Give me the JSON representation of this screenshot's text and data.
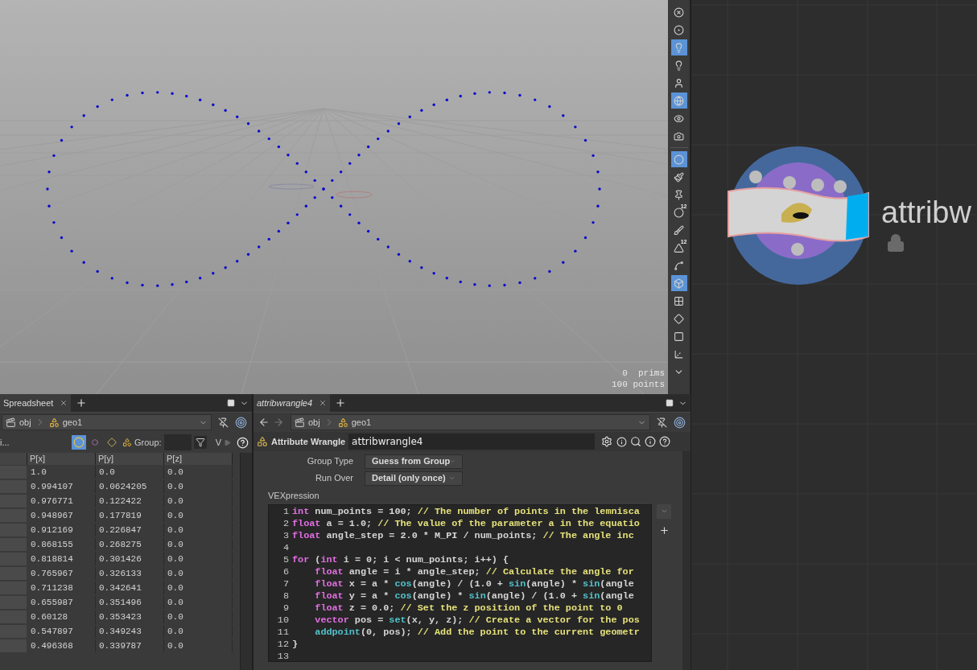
{
  "viewport": {
    "stats": [
      "0  prims",
      "100 points"
    ]
  },
  "viewport_toolbar": [
    {
      "kind": "xray",
      "selected": false
    },
    {
      "kind": "light-circle",
      "selected": false
    },
    {
      "kind": "bulb",
      "selected": true
    },
    {
      "kind": "bulb-small",
      "selected": false
    },
    {
      "kind": "person-bulb",
      "selected": false
    },
    {
      "kind": "shaded-ball",
      "selected": true
    },
    {
      "kind": "eye",
      "selected": false
    },
    {
      "kind": "camera",
      "selected": false
    },
    {
      "kind": "point",
      "selected": true
    },
    {
      "kind": "brush",
      "selected": false
    },
    {
      "kind": "pin",
      "selected": false
    },
    {
      "kind": "point-numbers",
      "selected": false,
      "label": "12"
    },
    {
      "kind": "brush-small",
      "selected": false
    },
    {
      "kind": "prim-numbers",
      "selected": false,
      "label": "12"
    },
    {
      "kind": "curve",
      "selected": false
    },
    {
      "kind": "shaded-surface",
      "selected": true
    },
    {
      "kind": "checker",
      "selected": false
    },
    {
      "kind": "diamond",
      "selected": false
    },
    {
      "kind": "green-square",
      "selected": false
    },
    {
      "kind": "handle",
      "selected": false
    },
    {
      "kind": "down-arrow",
      "selected": false
    }
  ],
  "spreadsheet": {
    "tab": "Spreadsheet",
    "path": [
      "obj",
      "geo1"
    ],
    "filter_label": "i...",
    "group_label": "Group:",
    "view_label": "V",
    "columns": [
      "P[x]",
      "P[y]",
      "P[z]"
    ],
    "rows": [
      [
        "1.0",
        "0.0",
        "0.0"
      ],
      [
        "0.994107",
        "0.0624205",
        "0.0"
      ],
      [
        "0.976771",
        "0.122422",
        "0.0"
      ],
      [
        "0.948967",
        "0.177819",
        "0.0"
      ],
      [
        "0.912169",
        "0.226847",
        "0.0"
      ],
      [
        "0.868155",
        "0.268275",
        "0.0"
      ],
      [
        "0.818814",
        "0.301426",
        "0.0"
      ],
      [
        "0.765967",
        "0.326133",
        "0.0"
      ],
      [
        "0.711238",
        "0.342641",
        "0.0"
      ],
      [
        "0.655987",
        "0.351496",
        "0.0"
      ],
      [
        "0.60128",
        "0.353423",
        "0.0"
      ],
      [
        "0.547897",
        "0.349243",
        "0.0"
      ],
      [
        "0.496368",
        "0.339787",
        "0.0"
      ]
    ]
  },
  "parameters": {
    "tab": "attribwrangle4",
    "path": [
      "obj",
      "geo1"
    ],
    "node_type": "Attribute Wrangle",
    "node_name": "attribwrangle4",
    "fields": [
      {
        "label": "Group Type",
        "value": "Guess from Group"
      },
      {
        "label": "Run Over",
        "value": "Detail (only once)"
      }
    ],
    "code_label": "VEXpression",
    "code_lines": [
      {
        "number": "1",
        "indented": false,
        "segments": [
          {
            "kind": "keyword",
            "text": "int"
          },
          {
            "kind": "plain",
            "text": " num_points = 100; "
          },
          {
            "kind": "comment",
            "text": "// The number of points in the lemnisca"
          }
        ]
      },
      {
        "number": "2",
        "indented": false,
        "segments": [
          {
            "kind": "keyword",
            "text": "float"
          },
          {
            "kind": "plain",
            "text": " a = 1.0; "
          },
          {
            "kind": "comment",
            "text": "// The value of the parameter a in the equatio"
          }
        ]
      },
      {
        "number": "3",
        "indented": false,
        "segments": [
          {
            "kind": "keyword",
            "text": "float"
          },
          {
            "kind": "plain",
            "text": " angle_step = 2.0 * M_PI / num_points; "
          },
          {
            "kind": "comment",
            "text": "// The angle inc"
          }
        ]
      },
      {
        "number": "4"
      },
      {
        "number": "5",
        "indented": false,
        "segments": [
          {
            "kind": "keyword",
            "text": "for"
          },
          {
            "kind": "plain",
            "text": " ("
          },
          {
            "kind": "keyword",
            "text": "int"
          },
          {
            "kind": "plain",
            "text": " i = 0; i < num_points; i++) {"
          }
        ]
      },
      {
        "number": "6",
        "indented": true,
        "segments": [
          {
            "kind": "keyword",
            "text": "float"
          },
          {
            "kind": "plain",
            "text": " angle = i * angle_step; "
          },
          {
            "kind": "comment",
            "text": "// Calculate the angle for"
          }
        ]
      },
      {
        "number": "7",
        "indented": true,
        "segments": [
          {
            "kind": "keyword",
            "text": "float"
          },
          {
            "kind": "plain",
            "text": " x = a * "
          },
          {
            "kind": "function",
            "text": "cos"
          },
          {
            "kind": "plain",
            "text": "(angle) / (1.0 + "
          },
          {
            "kind": "function",
            "text": "sin"
          },
          {
            "kind": "plain",
            "text": "(angle) * "
          },
          {
            "kind": "function",
            "text": "sin"
          },
          {
            "kind": "plain",
            "text": "(angle"
          }
        ]
      },
      {
        "number": "8",
        "indented": true,
        "segments": [
          {
            "kind": "keyword",
            "text": "float"
          },
          {
            "kind": "plain",
            "text": " y = a * "
          },
          {
            "kind": "function",
            "text": "cos"
          },
          {
            "kind": "plain",
            "text": "(angle) * "
          },
          {
            "kind": "function",
            "text": "sin"
          },
          {
            "kind": "plain",
            "text": "(angle) / (1.0 + "
          },
          {
            "kind": "function",
            "text": "sin"
          },
          {
            "kind": "plain",
            "text": "(angle"
          }
        ]
      },
      {
        "number": "9",
        "indented": true,
        "segments": [
          {
            "kind": "keyword",
            "text": "float"
          },
          {
            "kind": "plain",
            "text": " z = 0.0; "
          },
          {
            "kind": "comment",
            "text": "// Set the z position of the point to 0"
          }
        ]
      },
      {
        "number": "10",
        "indented": true,
        "segments": [
          {
            "kind": "keyword",
            "text": "vector"
          },
          {
            "kind": "plain",
            "text": " pos = "
          },
          {
            "kind": "function",
            "text": "set"
          },
          {
            "kind": "plain",
            "text": "(x, y, z); "
          },
          {
            "kind": "comment",
            "text": "// Create a vector for the pos"
          }
        ]
      },
      {
        "number": "11",
        "indented": true,
        "segments": [
          {
            "kind": "function",
            "text": "addpoint"
          },
          {
            "kind": "plain",
            "text": "(0, pos); "
          },
          {
            "kind": "comment",
            "text": "// Add the point to the current geometr"
          }
        ]
      },
      {
        "number": "12",
        "indented": false,
        "segments": [
          {
            "kind": "plain",
            "text": "}"
          }
        ]
      },
      {
        "number": "13"
      }
    ]
  },
  "network": {
    "node": {
      "label": "attribw",
      "locked": true
    }
  }
}
